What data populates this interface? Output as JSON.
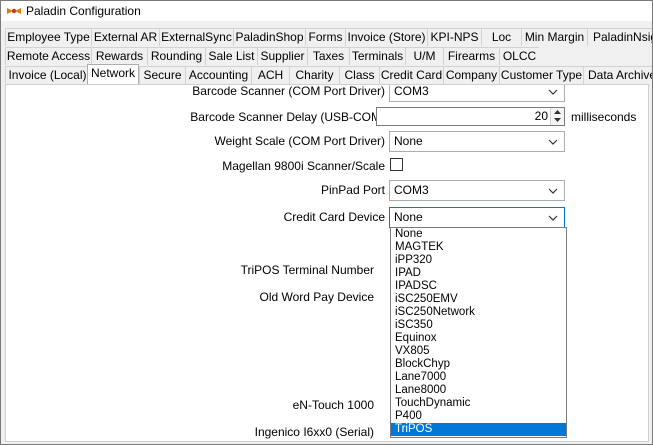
{
  "window": {
    "title": "Paladin Configuration",
    "icon": "paladin-logo-icon"
  },
  "tabs": {
    "row1": [
      "Employee Type",
      "External AR",
      "ExternalSync",
      "PaladinShop",
      "Forms",
      "Invoice (Store)",
      "KPI-NPS",
      "Loc",
      "Min Margin",
      "PaladinNsigh"
    ],
    "row2": [
      "Remote Access",
      "Rewards",
      "Rounding",
      "Sale List",
      "Supplier",
      "Taxes",
      "Terminals",
      "U/M",
      "Firearms",
      "OLCC"
    ],
    "row3": [
      "Invoice (Local)",
      "Network",
      "Secure",
      "Accounting",
      "ACH",
      "Charity",
      "Class",
      "Credit Card",
      "Company",
      "Customer Type",
      "Data Archive"
    ],
    "selected": "Network"
  },
  "form": {
    "barcode_scanner_label": "Barcode Scanner (COM Port Driver)",
    "barcode_scanner_value": "COM3",
    "barcode_delay_label": "Barcode Scanner Delay (USB-COM)",
    "barcode_delay_value": "20",
    "barcode_delay_unit": "milliseconds",
    "weight_scale_label": "Weight Scale (COM Port Driver)",
    "weight_scale_value": "None",
    "magellan_label": "Magellan 9800i Scanner/Scale",
    "magellan_checked": false,
    "pinpad_label": "PinPad Port",
    "pinpad_value": "COM3",
    "credit_card_device_label": "Credit Card Device",
    "credit_card_device_value": "None",
    "tripos_terminal_label": "TriPOS Terminal Number",
    "old_word_pay_label": "Old Word Pay Device",
    "entouch_label": "eN-Touch 1000",
    "ingenico_label": "Ingenico I6xx0 (Serial)"
  },
  "dropdown": {
    "options": [
      "None",
      "MAGTEK",
      "iPP320",
      "IPAD",
      "IPADSC",
      "iSC250EMV",
      "iSC250Network",
      "iSC350",
      "Equinox",
      "VX805",
      "BlockChyp",
      "Lane7000",
      "Lane8000",
      "TouchDynamic",
      "P400",
      "TriPOS"
    ],
    "highlighted": "TriPOS"
  }
}
